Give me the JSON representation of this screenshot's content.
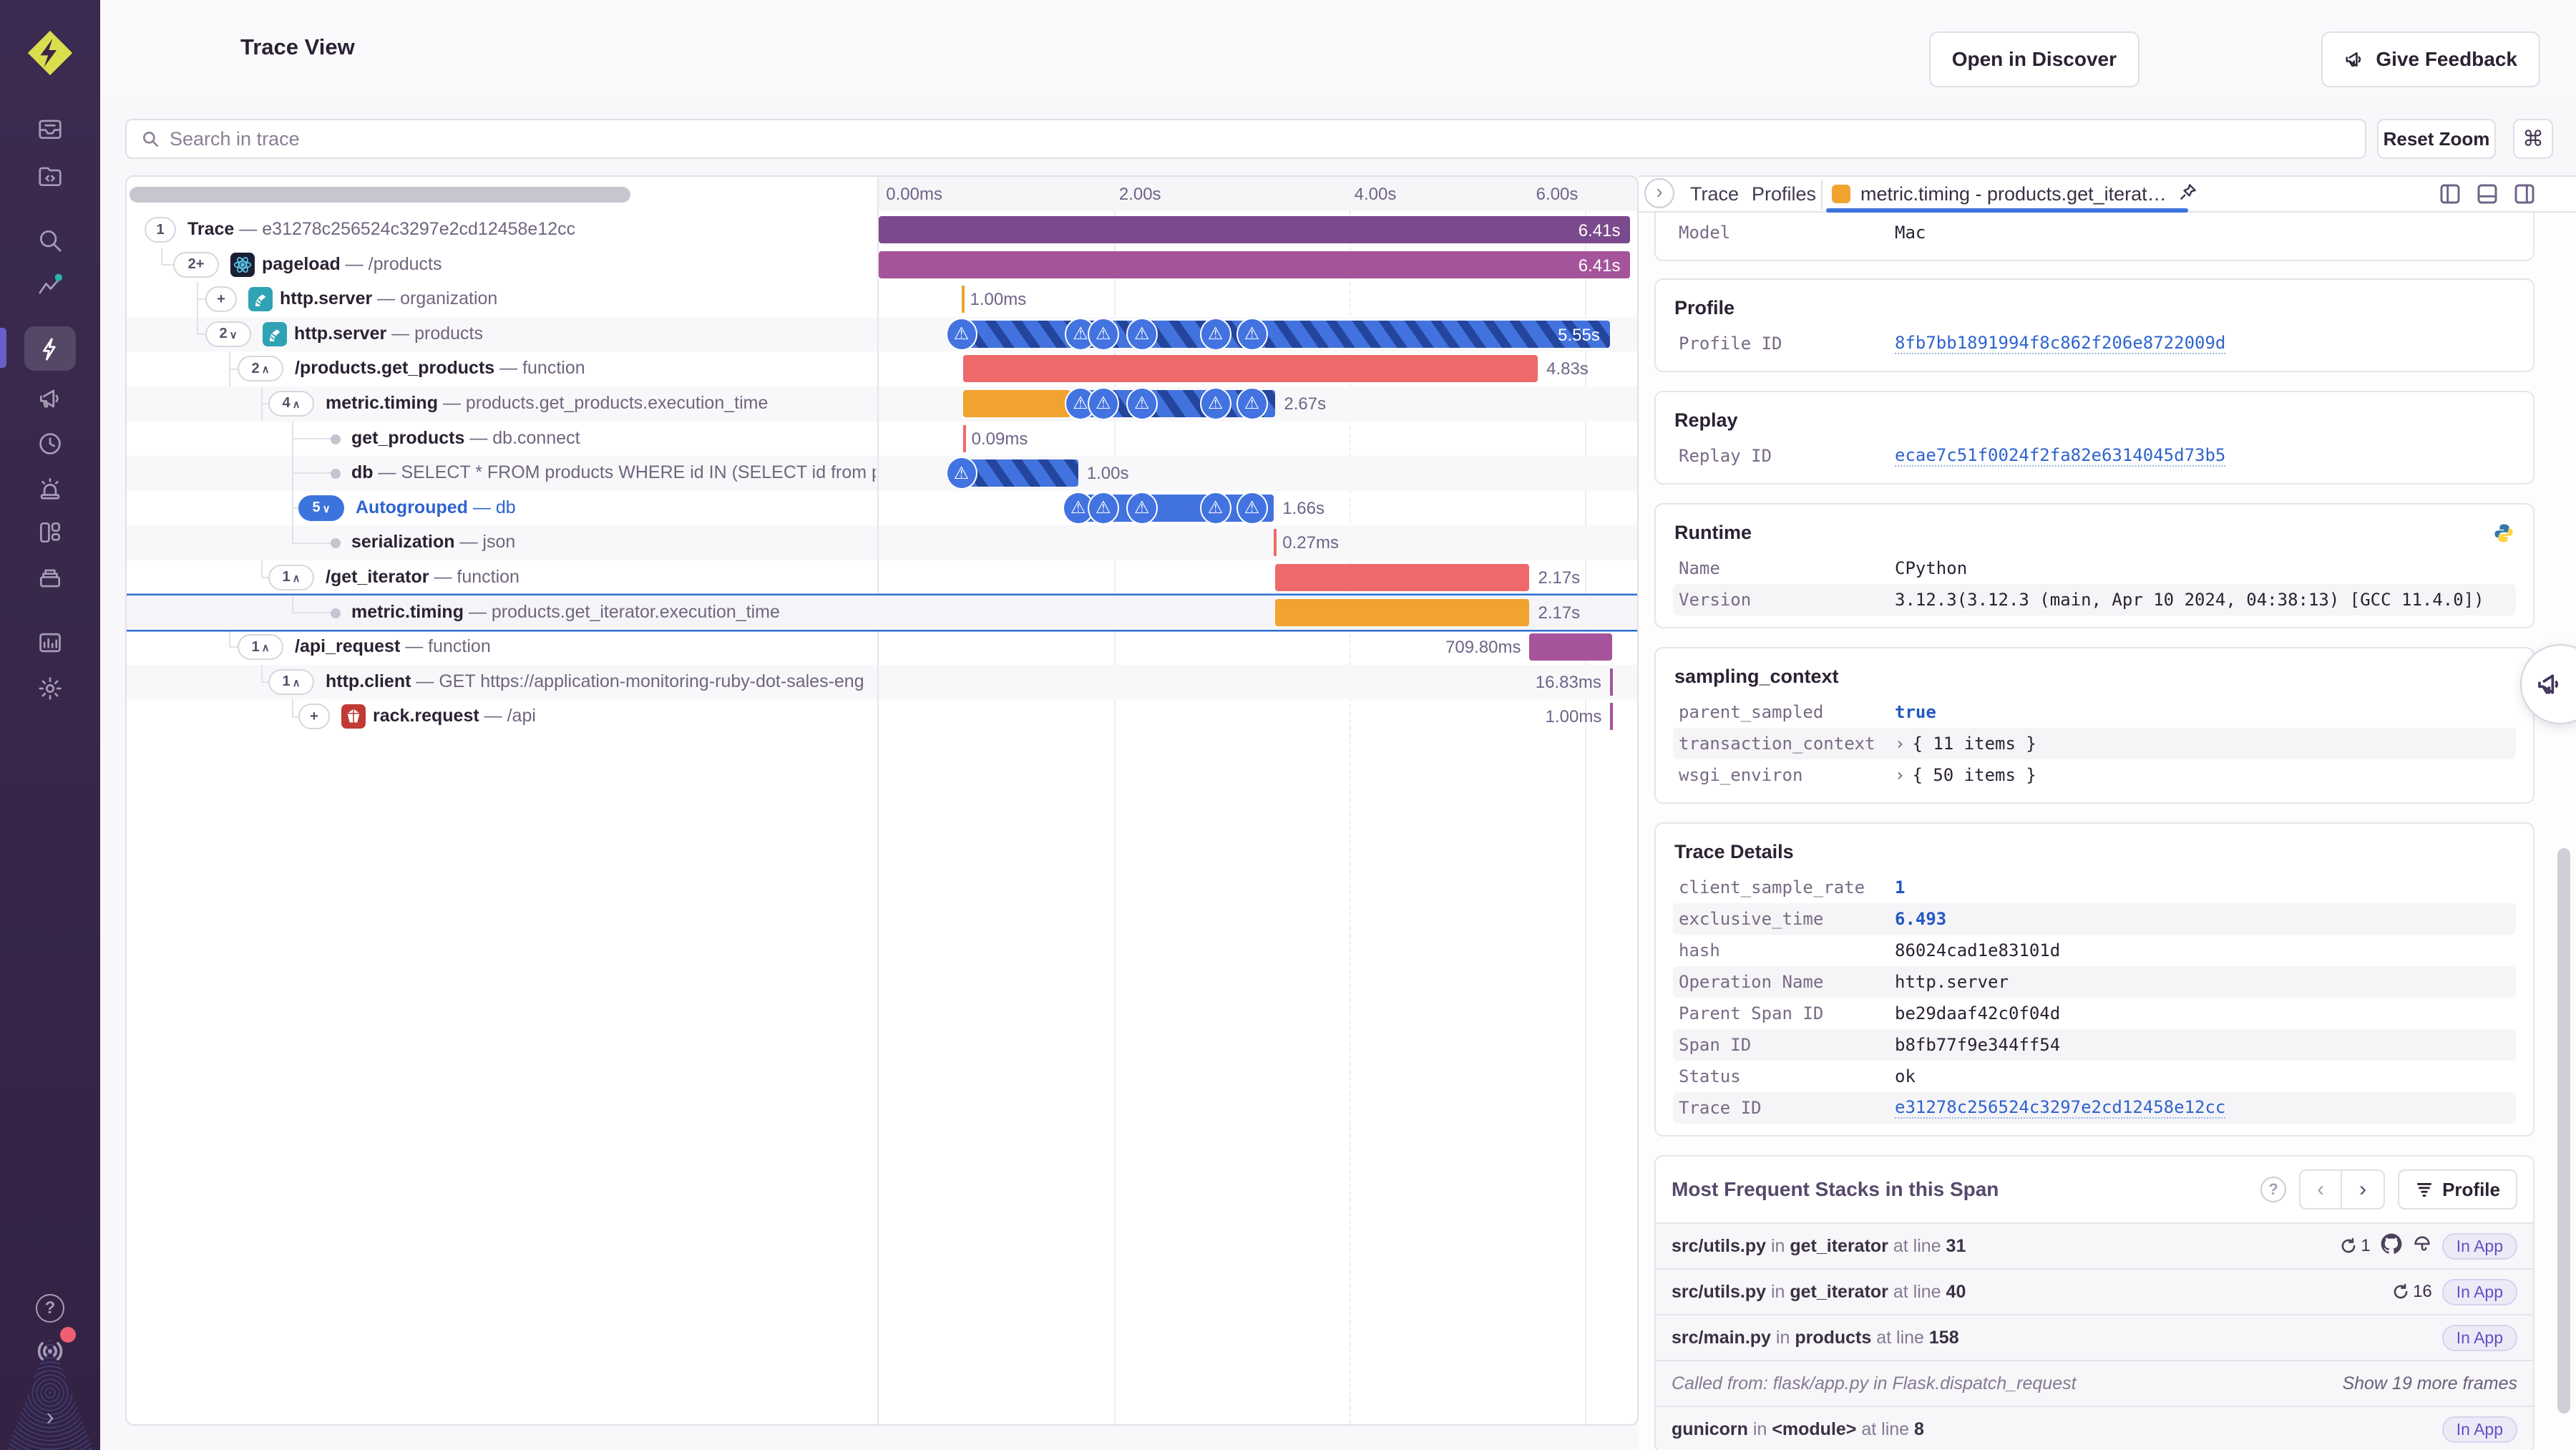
{
  "header": {
    "title": "Trace View",
    "open_in_discover": "Open in Discover",
    "give_feedback": "Give Feedback"
  },
  "toolbar": {
    "search_placeholder": "Search in trace",
    "reset_zoom": "Reset Zoom",
    "cmd_key": "⌘"
  },
  "sidebar": {
    "icons": [
      "issues",
      "projects",
      "search",
      "insights",
      "performance",
      "feedback",
      "replays",
      "alerts",
      "dashboards",
      "stats",
      "reports",
      "settings"
    ],
    "active_icon": "performance",
    "footer_icons": [
      "help",
      "whats-new",
      "collapse"
    ],
    "help_glyph": "?",
    "collapse_glyph": "›"
  },
  "colors": {
    "accent_blue": "#3c74dd",
    "purple_bar": "#7b4a8c",
    "magenta_bar": "#a5549b",
    "red_bar": "#ee6a6a",
    "orange_bar": "#f0a32e",
    "blue_bar": "#4272de",
    "stripe_dark": "#24459d",
    "nav_indicator": "#6a5fc8",
    "warn_chip": "#4273e0"
  },
  "ruler": {
    "ticks": [
      {
        "label": "0.00ms",
        "frac": 0.004,
        "align": "left"
      },
      {
        "label": "2.00s",
        "frac": 0.31,
        "align": "left"
      },
      {
        "label": "4.00s",
        "frac": 0.619,
        "align": "left"
      },
      {
        "label": "6.00s",
        "frac": 0.928,
        "align": "right"
      }
    ]
  },
  "trace_rows": [
    {
      "badge": "1",
      "level": 0,
      "name": "Trace",
      "sep": "—",
      "desc": "e31278c256524c3297e2cd12458e12cc",
      "bar": {
        "segs": [
          {
            "c": "purple",
            "l": 0,
            "w": 0.991
          }
        ],
        "label": "6.41s",
        "pos": "inside"
      }
    },
    {
      "badge": "2+",
      "level": 1,
      "parent": 0,
      "icon": "react",
      "name": "pageload",
      "sep": "—",
      "desc": "/products",
      "bar": {
        "segs": [
          {
            "c": "magenta",
            "l": 0,
            "w": 0.991
          }
        ],
        "label": "6.41s",
        "pos": "inside"
      }
    },
    {
      "badge": "+",
      "level": 2,
      "parent": 1,
      "icon": "flask",
      "name": "http.server",
      "sep": "—",
      "desc": "organization",
      "bar": {
        "tick": "orange",
        "l": 0.109,
        "label": "1.00ms",
        "pos": "after"
      }
    },
    {
      "badge": "2",
      "chev": "∨",
      "level": 2,
      "parent": 1,
      "icon": "flask",
      "name": "http.server",
      "sep": "—",
      "desc": "products",
      "shade": true,
      "bar": {
        "segs": [
          {
            "c": "stripes",
            "l": 0.096,
            "w": 0.868
          }
        ],
        "label": "5.55s",
        "pos": "inside",
        "warns": [
          0.109,
          0.266,
          0.296,
          0.347,
          0.444,
          0.492
        ]
      }
    },
    {
      "badge": "2",
      "chev": "∧",
      "level": 3,
      "parent": 3,
      "name": "/products.get_products",
      "sep": "—",
      "desc": "function",
      "bar": {
        "segs": [
          {
            "c": "red",
            "l": 0.111,
            "w": 0.758
          }
        ],
        "label": "4.83s",
        "pos": "after"
      }
    },
    {
      "badge": "4",
      "chev": "∧",
      "level": 4,
      "parent": 4,
      "name": "metric.timing",
      "sep": "—",
      "desc": "products.get_products.execution_time",
      "shade": true,
      "bar": {
        "segs": [
          {
            "c": "orange",
            "l": 0.111,
            "w": 0.142
          },
          {
            "c": "stripes",
            "l": 0.253,
            "w": 0.27
          }
        ],
        "label": "2.67s",
        "pos": "after",
        "warns": [
          0.266,
          0.296,
          0.347,
          0.444,
          0.492
        ]
      }
    },
    {
      "dot": true,
      "level": 5,
      "parent": 5,
      "name": "get_products",
      "sep": "—",
      "desc": "db.connect",
      "bar": {
        "tick": "red",
        "l": 0.111,
        "label": "0.09ms",
        "pos": "after"
      }
    },
    {
      "dot": true,
      "level": 5,
      "parent": 5,
      "name": "db",
      "sep": "—",
      "desc": "SELECT * FROM products WHERE id IN (SELECT id from produ",
      "shade": true,
      "bar": {
        "segs": [
          {
            "c": "stripes",
            "l": 0.096,
            "w": 0.167
          }
        ],
        "label": "1.00s",
        "pos": "after",
        "warns": [
          0.109
        ]
      }
    },
    {
      "badge": "5",
      "chev": "∨",
      "badge_blue": true,
      "level": 5,
      "parent": 5,
      "name": "Autogrouped",
      "sep": "—",
      "desc": "db",
      "blue_text": true,
      "bar": {
        "segs": [
          {
            "c": "blue",
            "l": 0.25,
            "w": 0.271
          }
        ],
        "label": "1.66s",
        "pos": "after",
        "warns": [
          0.263,
          0.296,
          0.347,
          0.444,
          0.492
        ]
      }
    },
    {
      "dot": true,
      "level": 5,
      "parent": 5,
      "name": "serialization",
      "sep": "—",
      "desc": "json",
      "shade": true,
      "bar": {
        "tick": "red",
        "l": 0.521,
        "label": "0.27ms",
        "pos": "after"
      }
    },
    {
      "badge": "1",
      "chev": "∧",
      "level": 4,
      "parent": 4,
      "name": "/get_iterator",
      "sep": "—",
      "desc": "function",
      "bar": {
        "segs": [
          {
            "c": "red",
            "l": 0.523,
            "w": 0.335
          }
        ],
        "label": "2.17s",
        "pos": "after"
      }
    },
    {
      "dot": true,
      "level": 5,
      "parent": 10,
      "name": "metric.timing",
      "sep": "—",
      "desc": "products.get_iterator.execution_time",
      "selected": true,
      "bar": {
        "segs": [
          {
            "c": "orange",
            "l": 0.523,
            "w": 0.335
          }
        ],
        "label": "2.17s",
        "pos": "after"
      }
    },
    {
      "badge": "1",
      "chev": "∧",
      "level": 3,
      "parent": 3,
      "name": "/api_request",
      "sep": "—",
      "desc": "function",
      "bar": {
        "segs": [
          {
            "c": "magenta",
            "l": 0.858,
            "w": 0.109
          }
        ],
        "label": "709.80ms",
        "pos": "before"
      }
    },
    {
      "badge": "1",
      "chev": "∧",
      "level": 4,
      "parent": 12,
      "name": "http.client",
      "sep": "—",
      "desc": "GET https://application-monitoring-ruby-dot-sales-eng",
      "shade": true,
      "bar": {
        "tick": "magenta",
        "l": 0.964,
        "label": "16.83ms",
        "pos": "before"
      }
    },
    {
      "badge": "+",
      "level": 5,
      "parent": 13,
      "icon": "ruby",
      "name": "rack.request",
      "sep": "—",
      "desc": "/api",
      "bar": {
        "tick": "magenta",
        "l": 0.9645,
        "label": "1.00ms",
        "pos": "before"
      }
    }
  ],
  "tabs": {
    "collapse_glyph": "›",
    "items": [
      "Trace",
      "Profiles"
    ],
    "active_label": "metric.timing - products.get_iterat…"
  },
  "cards": [
    {
      "cut_top": true,
      "rows": [
        {
          "k": "Model",
          "v": "Mac"
        }
      ]
    },
    {
      "title": "Profile",
      "rows": [
        {
          "k": "Profile ID",
          "v": "8fb7bb1891994f8c862f206e8722009d",
          "link": true
        }
      ]
    },
    {
      "title": "Replay",
      "rows": [
        {
          "k": "Replay ID",
          "v": "ecae7c51f0024f2fa82e6314045d73b5",
          "link": true
        }
      ]
    },
    {
      "title": "Runtime",
      "icon": "python",
      "rows": [
        {
          "k": "Name",
          "v": "CPython"
        },
        {
          "k": "Version",
          "v": "3.12.3(3.12.3 (main, Apr 10 2024, 04:38:13) [GCC 11.4.0])",
          "shade": true
        }
      ]
    },
    {
      "title": "sampling_context",
      "rows": [
        {
          "k": "parent_sampled",
          "v": "true",
          "blue": true
        },
        {
          "k": "transaction_context",
          "v": "{ 11 items }",
          "expand": "›",
          "shade": true
        },
        {
          "k": "wsgi_environ",
          "v": "{ 50 items }",
          "expand": "›"
        }
      ]
    },
    {
      "title": "Trace Details",
      "rows": [
        {
          "k": "client_sample_rate",
          "v": "1",
          "blue": true
        },
        {
          "k": "exclusive_time",
          "v": "6.493",
          "blue": true,
          "shade": true
        },
        {
          "k": "hash",
          "v": "86024cad1e83101d"
        },
        {
          "k": "Operation Name",
          "v": "http.server",
          "shade": true
        },
        {
          "k": "Parent Span ID",
          "v": "be29daaf42c0f04d"
        },
        {
          "k": "Span ID",
          "v": "b8fb77f9e344ff54",
          "shade": true
        },
        {
          "k": "Status",
          "v": "ok"
        },
        {
          "k": "Trace ID",
          "v": "e31278c256524c3297e2cd12458e12cc",
          "link": true,
          "shade": true
        }
      ]
    }
  ],
  "stacks": {
    "title": "Most Frequent Stacks in this Span",
    "help_glyph": "?",
    "prev_glyph": "‹",
    "next_glyph": "›",
    "profile_button": "Profile",
    "in_app": "In App",
    "rows": [
      {
        "file": "src/utils.py",
        "in": "in",
        "fn": "get_iterator",
        "at": "at line",
        "line": "31",
        "count": "1",
        "github": true,
        "coverage": true,
        "in_app": true
      },
      {
        "file": "src/utils.py",
        "in": "in",
        "fn": "get_iterator",
        "at": "at line",
        "line": "40",
        "count": "16",
        "in_app": true
      },
      {
        "file": "src/main.py",
        "in": "in",
        "fn": "products",
        "at": "at line",
        "line": "158",
        "in_app": true
      },
      {
        "called_from": "Called from: flask/app.py in Flask.dispatch_request",
        "more": "Show 19 more frames"
      },
      {
        "file": "gunicorn",
        "in": "in",
        "fn": "<module>",
        "at": "at line",
        "line": "8",
        "in_app": true
      }
    ]
  }
}
